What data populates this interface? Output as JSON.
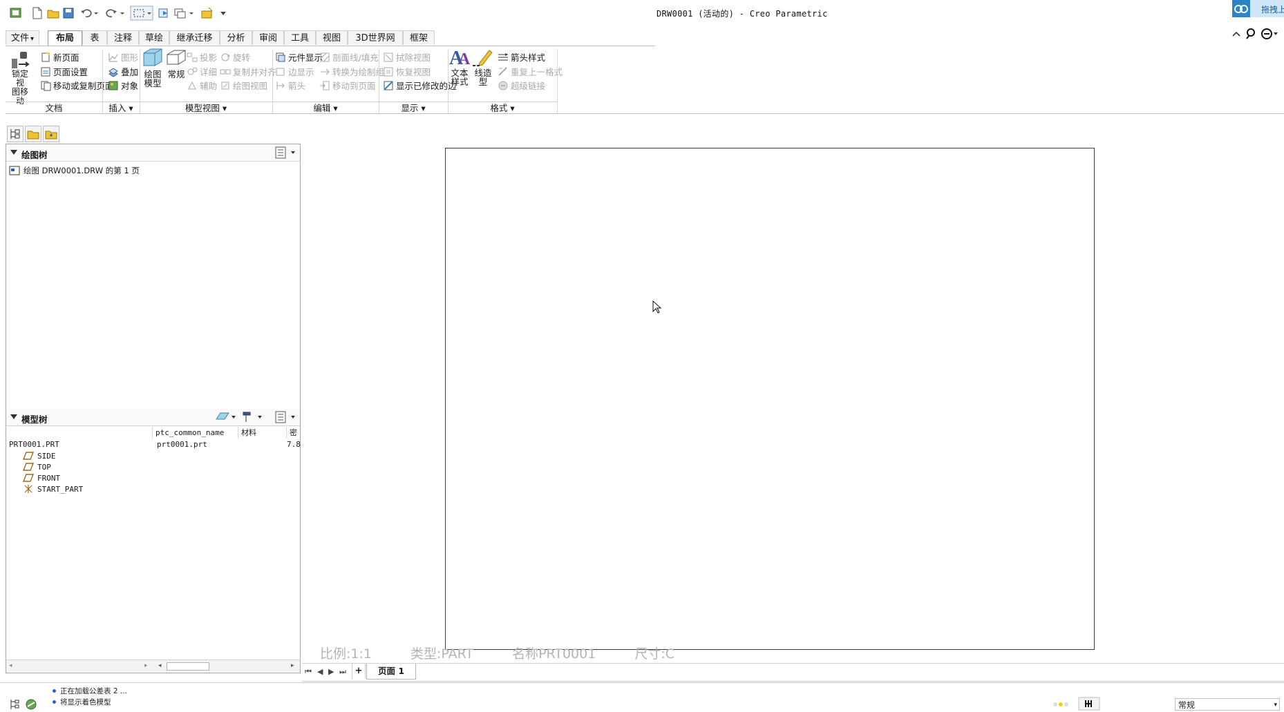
{
  "window": {
    "title": "DRW0001 (活动的) - Creo Parametric",
    "corner_badge": "拖拽上"
  },
  "menu_tabs": [
    {
      "label": "文件",
      "active": false
    },
    {
      "label": "布局",
      "active": true
    },
    {
      "label": "表",
      "active": false
    },
    {
      "label": "注释",
      "active": false
    },
    {
      "label": "草绘",
      "active": false
    },
    {
      "label": "继承迁移",
      "active": false
    },
    {
      "label": "分析",
      "active": false
    },
    {
      "label": "审阅",
      "active": false
    },
    {
      "label": "工具",
      "active": false
    },
    {
      "label": "视图",
      "active": false
    },
    {
      "label": "3D世界网",
      "active": false
    },
    {
      "label": "框架",
      "active": false
    }
  ],
  "file_dropdown_caret": "▾",
  "ribbon": {
    "document": {
      "lock_view_move": "锁定视\n图移动",
      "new_page": "新页面",
      "page_setup": "页面设置",
      "move_copy_page": "移动或复制页面",
      "group_label": "文档"
    },
    "insert": {
      "graphic": "图形",
      "overlay": "叠加",
      "object": "对象",
      "group_label": "插入 ▾"
    },
    "model_views": {
      "drawing_model": "绘图\n模型",
      "general": "常规",
      "projection": "投影",
      "detail": "详细",
      "auxiliary": "辅助",
      "rotate": "旋转",
      "copy_align": "复制并对齐",
      "drawing_view": "绘图视图",
      "group_label": "模型视图 ▾"
    },
    "edit": {
      "component_display": "元件显示",
      "edge_display": "边显示",
      "arrow": "箭头",
      "section_fill": "剖面线/填充",
      "convert_drawing_group": "转换为绘制组",
      "move_to_page": "移动到页面",
      "group_label": "编辑 ▾"
    },
    "display": {
      "erase_view": "拭除视图",
      "restore_view": "恢复视图",
      "show_modified_edges": "显示已修改的边",
      "group_label": "显示 ▾"
    },
    "format": {
      "text_style": "文本\n样式",
      "line_style": "线造\n型",
      "arrow_style": "箭头样式",
      "repeat_last_format": "重复上一格式",
      "hyperlink": "超级链接",
      "group_label": "格式 ▾"
    }
  },
  "drawing_tree": {
    "title": "绘图树",
    "items": [
      "绘图 DRW0001.DRW 的第 1 页"
    ]
  },
  "model_tree": {
    "title": "模型树",
    "columns": [
      "",
      "ptc_common_name",
      "材料",
      "密"
    ],
    "root": {
      "name": "PRT0001.PRT",
      "common_name": "prt0001.prt",
      "material": "",
      "density": "7.8"
    },
    "children": [
      {
        "name": "SIDE",
        "icon": "datum-plane-icon"
      },
      {
        "name": "TOP",
        "icon": "datum-plane-icon"
      },
      {
        "name": "FRONT",
        "icon": "datum-plane-icon"
      },
      {
        "name": "START_PART",
        "icon": "coordinate-system-icon"
      }
    ]
  },
  "sheet_info": {
    "scale": "比例:1:1",
    "type": "类型:PART",
    "name": "名称PRT0001",
    "size": "尺寸:C"
  },
  "page_tab": "页面 1",
  "add_page": "+",
  "status": {
    "messages": [
      "正在加载公差表 2 ...",
      "将显示着色模型"
    ],
    "filter": "常规"
  },
  "colors": {
    "accent_blue": "#2d83c7",
    "disabled_text": "#a9a9a9",
    "sheet_border": "#3a3a3a",
    "sheet_info": "#b4b4b4"
  }
}
